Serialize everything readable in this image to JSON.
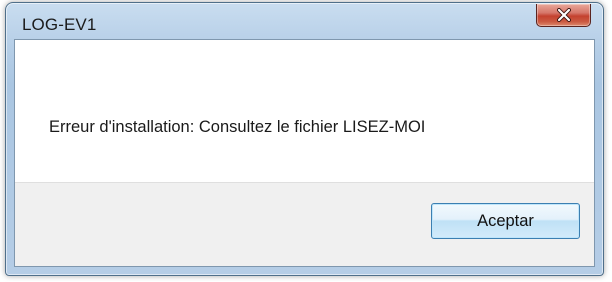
{
  "window": {
    "title": "LOG-EV1"
  },
  "titlebar": {
    "close_icon": "close-icon"
  },
  "dialog": {
    "message": "Erreur d'installation: Consultez le fichier LISEZ-MOI",
    "ok_label": "Aceptar"
  }
}
